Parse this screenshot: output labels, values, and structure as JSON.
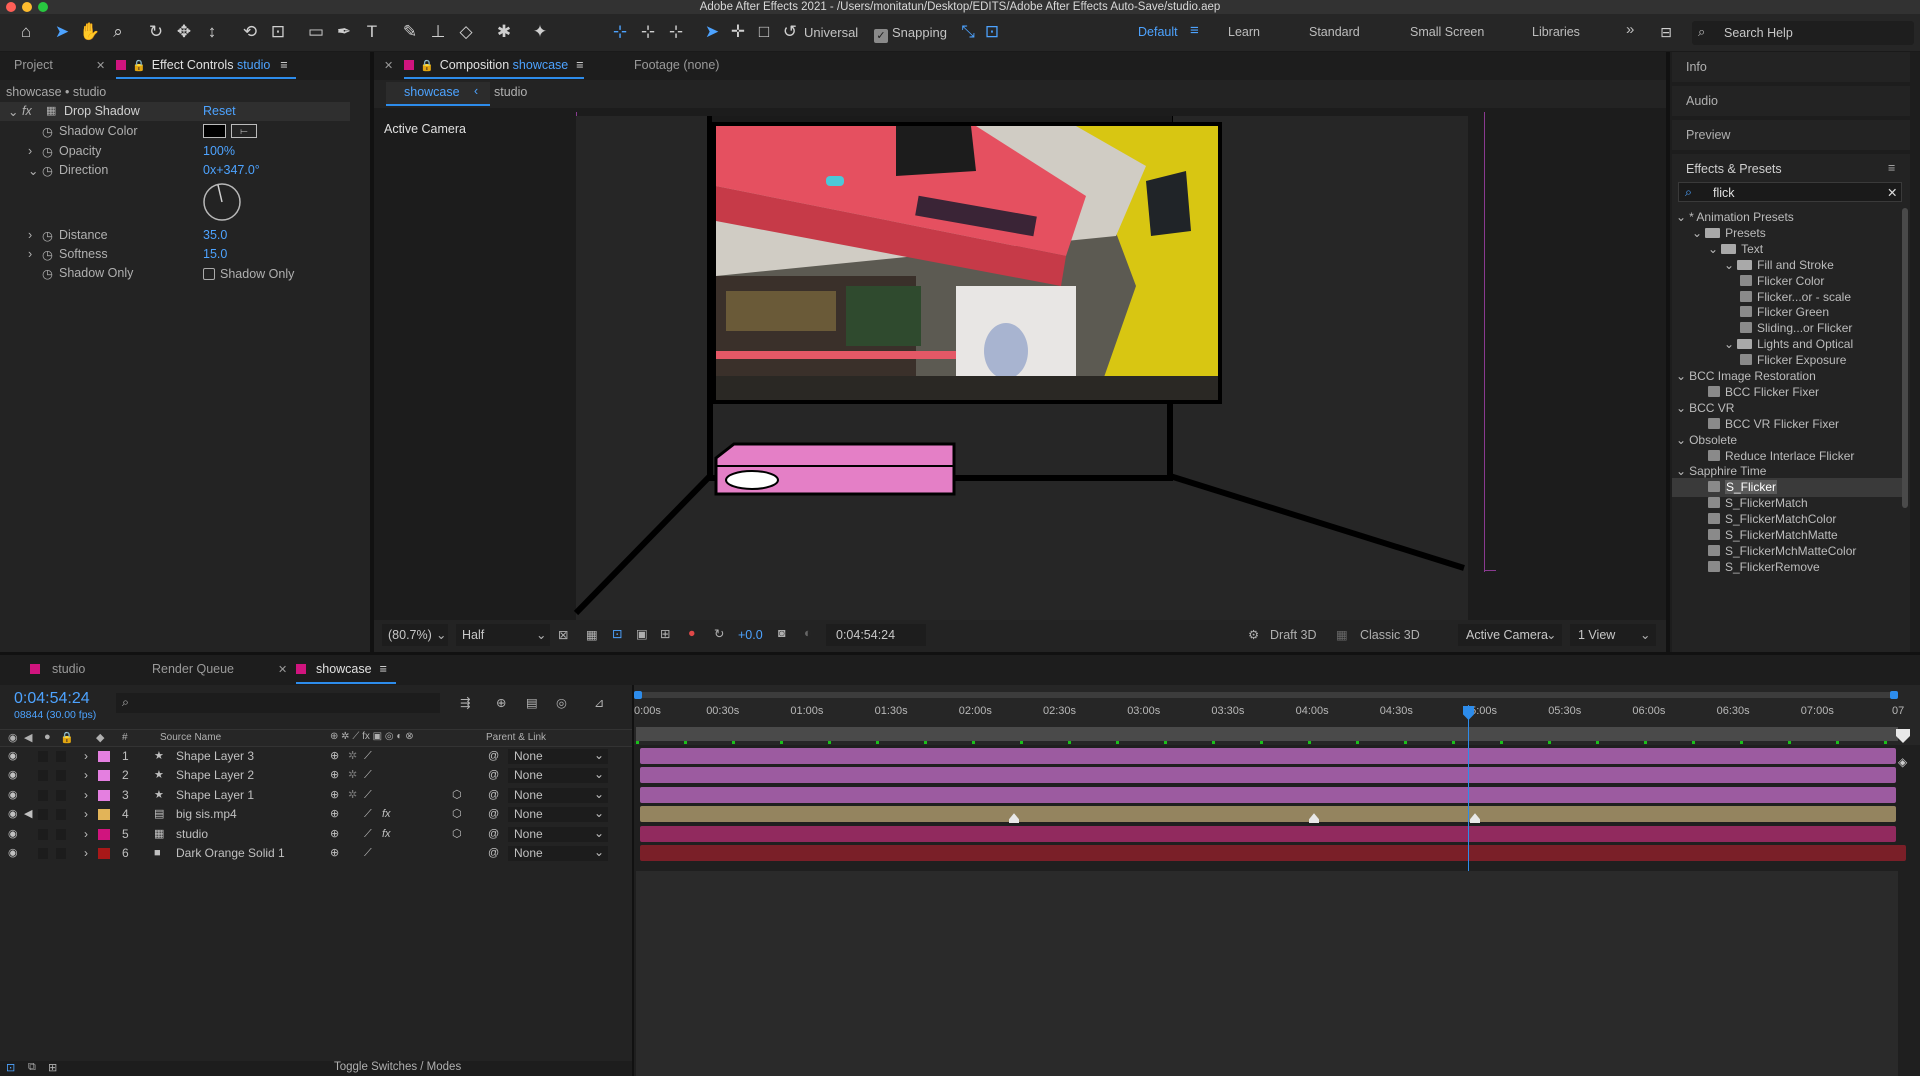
{
  "window": {
    "title": "Adobe After Effects 2021 - /Users/monitatun/Desktop/EDITS/Adobe After Effects Auto-Save/studio.aep"
  },
  "toolbar": {
    "universal": "Universal",
    "snapping": "Snapping",
    "workspaces": [
      "Default",
      "Learn",
      "Standard",
      "Small Screen",
      "Libraries"
    ],
    "search_help": "Search Help",
    "more": "»"
  },
  "left_panel": {
    "tab_project": "Project",
    "tab_effect_controls": "Effect Controls",
    "tab_effect_controls_target": "studio",
    "breadcrumb": "showcase • studio",
    "effect_name": "Drop Shadow",
    "reset": "Reset",
    "fx": "fx",
    "props": [
      {
        "label": "Shadow Color",
        "value": ""
      },
      {
        "label": "Opacity",
        "value": "100%"
      },
      {
        "label": "Direction",
        "value": "0x+347.0°"
      },
      {
        "label": "Distance",
        "value": "35.0"
      },
      {
        "label": "Softness",
        "value": "15.0"
      },
      {
        "label": "Shadow Only",
        "value": "Shadow Only"
      }
    ]
  },
  "composition": {
    "tab_label": "Composition",
    "tab_target": "showcase",
    "footage_tab": "Footage (none)",
    "sub_tabs": [
      "showcase",
      "studio"
    ],
    "active_camera": "Active Camera",
    "footer": {
      "zoom": "(80.7%)",
      "resolution": "Half",
      "exposure": "+0.0",
      "timecode": "0:04:54:24",
      "draft3d": "Draft 3D",
      "renderer": "Classic 3D",
      "camera": "Active Camera",
      "views": "1 View"
    }
  },
  "right_panel": {
    "sections": [
      "Info",
      "Audio",
      "Preview",
      "Effects & Presets"
    ],
    "search_value": "flick",
    "tree": [
      {
        "label": "* Animation Presets",
        "type": "group"
      },
      {
        "label": "Presets",
        "type": "folder"
      },
      {
        "label": "Text",
        "type": "folder"
      },
      {
        "label": "Fill and Stroke",
        "type": "folder"
      },
      {
        "label": "Flicker Color",
        "type": "item"
      },
      {
        "label": "Flicker...or - scale",
        "type": "item"
      },
      {
        "label": "Flicker Green",
        "type": "item"
      },
      {
        "label": "Sliding...or Flicker",
        "type": "item"
      },
      {
        "label": "Lights and Optical",
        "type": "folder"
      },
      {
        "label": "Flicker Exposure",
        "type": "item"
      },
      {
        "label": "BCC Image Restoration",
        "type": "group"
      },
      {
        "label": "BCC Flicker Fixer",
        "type": "item"
      },
      {
        "label": "BCC VR",
        "type": "group"
      },
      {
        "label": "BCC VR Flicker Fixer",
        "type": "item"
      },
      {
        "label": "Obsolete",
        "type": "group"
      },
      {
        "label": "Reduce Interlace Flicker",
        "type": "item"
      },
      {
        "label": "Sapphire Time",
        "type": "group"
      },
      {
        "label": "S_Flicker",
        "type": "item"
      },
      {
        "label": "S_FlickerMatch",
        "type": "item"
      },
      {
        "label": "S_FlickerMatchColor",
        "type": "item"
      },
      {
        "label": "S_FlickerMatchMatte",
        "type": "item"
      },
      {
        "label": "S_FlickerMchMatteColor",
        "type": "item"
      },
      {
        "label": "S_FlickerRemove",
        "type": "item"
      }
    ]
  },
  "timeline": {
    "tabs": [
      "studio",
      "Render Queue",
      "showcase"
    ],
    "timecode": "0:04:54:24",
    "frame_info": "08844 (30.00 fps)",
    "col_source_name": "Source Name",
    "col_parent": "Parent & Link",
    "col_num": "#",
    "ruler": [
      "0:00s",
      "00:30s",
      "01:00s",
      "01:30s",
      "02:00s",
      "02:30s",
      "03:00s",
      "03:30s",
      "04:00s",
      "04:30s",
      "05:00s",
      "05:30s",
      "06:00s",
      "06:30s",
      "07:00s",
      "07"
    ],
    "layers": [
      {
        "num": "1",
        "name": "Shape Layer 3",
        "parent": "None",
        "color": "#e47fe0",
        "bar_color": "#9c5ba0"
      },
      {
        "num": "2",
        "name": "Shape Layer 2",
        "parent": "None",
        "color": "#e47fe0",
        "bar_color": "#9c5ba0"
      },
      {
        "num": "3",
        "name": "Shape Layer 1",
        "parent": "None",
        "color": "#e47fe0",
        "bar_color": "#9c5ba0"
      },
      {
        "num": "4",
        "name": "big sis.mp4",
        "parent": "None",
        "color": "#e2b458",
        "bar_color": "#94845f"
      },
      {
        "num": "5",
        "name": "studio",
        "parent": "None",
        "color": "#d0147e",
        "bar_color": "#912a5e"
      },
      {
        "num": "6",
        "name": "Dark Orange Solid 1",
        "parent": "None",
        "color": "#a81818",
        "bar_color": "#7a1f28"
      }
    ],
    "toggle": "Toggle Switches / Modes"
  },
  "colors": {
    "accent": "#2d8ceb",
    "effect_controls_swatch": "#d0147e",
    "comp_swatch": "#d0147e"
  }
}
